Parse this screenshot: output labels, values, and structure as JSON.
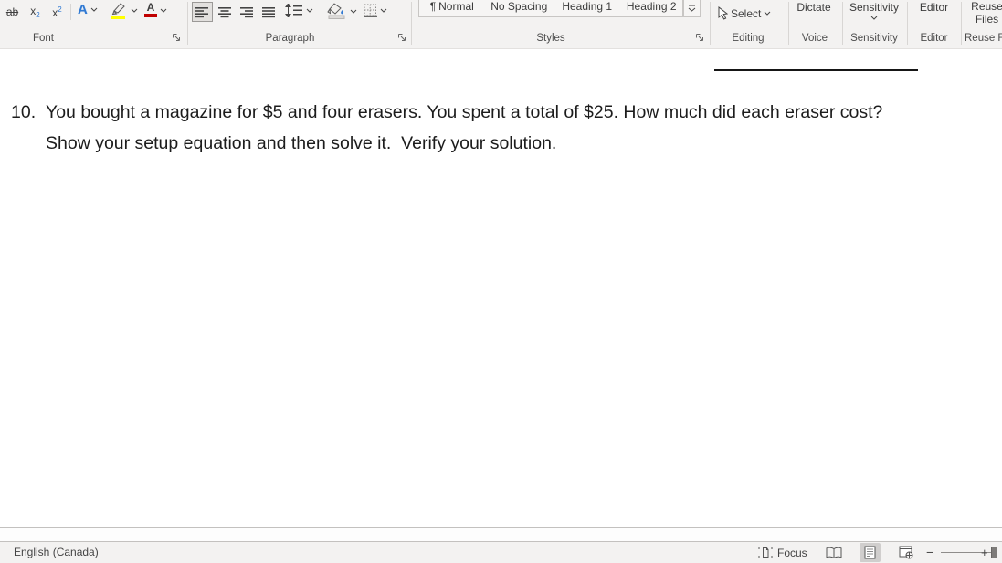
{
  "ribbon": {
    "font_group": {
      "label": "Font",
      "strikethrough_glyph": "ab",
      "sub_base": "x",
      "sub_small": "2",
      "sup_base": "x",
      "sup_small": "2",
      "text_effects_letter": "A",
      "font_color_letter": "A"
    },
    "paragraph_group": {
      "label": "Paragraph"
    },
    "styles_group": {
      "label": "Styles",
      "styles": [
        {
          "pilcrow": "¶",
          "name": "Normal"
        },
        {
          "name": "No Spacing"
        },
        {
          "name": "Heading 1"
        },
        {
          "name": "Heading 2"
        }
      ]
    },
    "editing_group": {
      "label": "Editing",
      "select_label": "Select"
    },
    "voice_group": {
      "label": "Voice",
      "dictate_label": "Dictate"
    },
    "sensitivity_group": {
      "label": "Sensitivity",
      "button_label": "Sensitivity"
    },
    "editor_group": {
      "label": "Editor",
      "button_label": "Editor"
    },
    "reuse_files_group": {
      "label": "Reuse Fi",
      "button_line1": "Reuse",
      "button_line2": "Files"
    }
  },
  "document": {
    "question_number": "10.",
    "question_text": "You bought a magazine for $5 and four erasers. You spent a total of $25. How much did each eraser cost? Show your setup equation and then solve it.  Verify your solution."
  },
  "status_bar": {
    "language": "English (Canada)",
    "focus_label": "Focus",
    "zoom_minus": "−",
    "zoom_plus": "+"
  },
  "colors": {
    "accent_blue": "#3179d2",
    "highlight_yellow": "#ffff00",
    "font_color_red": "#c00000",
    "ribbon_bg": "#f3f2f1"
  }
}
